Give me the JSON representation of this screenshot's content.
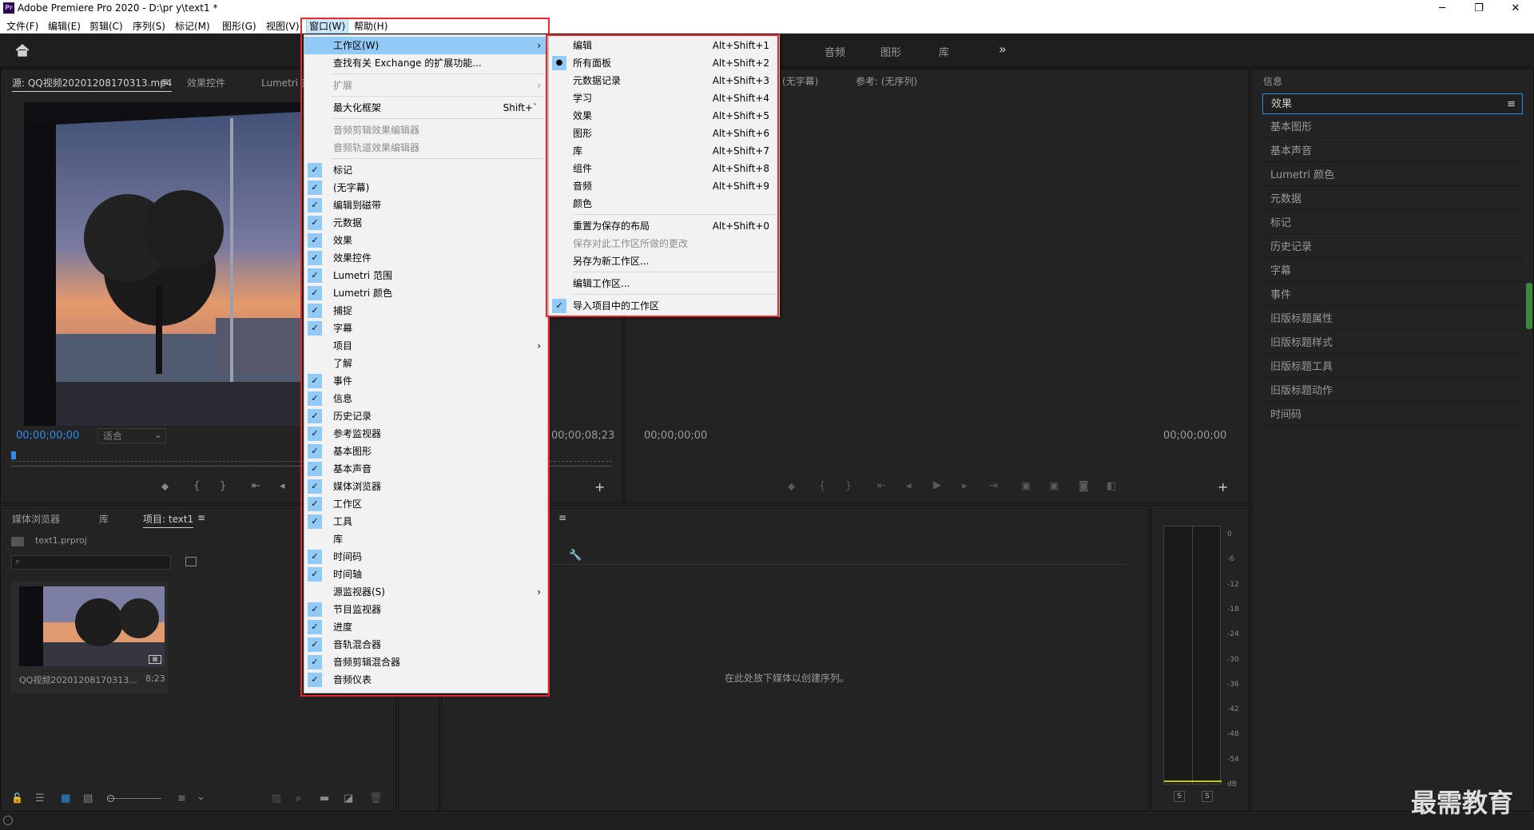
{
  "window": {
    "title": "Adobe Premiere Pro 2020 - D:\\pr y\\text1 *",
    "logo": "Pr",
    "minimize": "─",
    "maximize": "❐",
    "close": "✕"
  },
  "menubar": [
    "文件(F)",
    "编辑(E)",
    "剪辑(C)",
    "序列(S)",
    "标记(M)",
    "图形(G)",
    "视图(V)",
    "窗口(W)",
    "帮助(H)"
  ],
  "workspace_tabs": [
    "音频",
    "图形",
    "库"
  ],
  "workspace_more": "»",
  "source_panel": {
    "tabs": [
      "源: QQ视频20201208170313.mp4",
      "效果控件",
      "Lumetri 范"
    ],
    "menu_icon": "≡",
    "timecode_left": "00;00;00;00",
    "fit": "适合",
    "timecode_right": "00;00;08;23"
  },
  "program_panel": {
    "header_left": "(无字幕)",
    "header_ref": "参考: (无序列)",
    "timecode_left": "00;00;00;00",
    "timecode_right": "00;00;00;00"
  },
  "project_panel": {
    "tabs": [
      "媒体浏览器",
      "库",
      "项目: text1"
    ],
    "menu_icon": "≡",
    "file": "text1.prproj",
    "clip_name": "QQ视频20201208170313...",
    "clip_duration": "8;23"
  },
  "timeline_panel": {
    "empty_text": "在此处放下媒体以创建序列。",
    "menu_icon": "≡"
  },
  "meter": {
    "labels": [
      "0",
      "-6",
      "-12",
      "-18",
      "-24",
      "-30",
      "-36",
      "-42",
      "-48",
      "-54",
      "dB"
    ],
    "solo": [
      "S",
      "S"
    ]
  },
  "effects_panel": {
    "header": "信息",
    "items": [
      "效果",
      "基本图形",
      "基本声音",
      "Lumetri 颜色",
      "元数据",
      "标记",
      "历史记录",
      "字幕",
      "事件",
      "旧版标题属性",
      "旧版标题样式",
      "旧版标题工具",
      "旧版标题动作",
      "时间码"
    ],
    "menu_icon": "≡"
  },
  "window_menu": {
    "items": [
      {
        "label": "工作区(W)",
        "submenu": true,
        "highlight": true
      },
      {
        "label": "查找有关 Exchange 的扩展功能..."
      },
      {
        "sep": true
      },
      {
        "label": "扩展",
        "disabled": true,
        "submenu": true
      },
      {
        "sep": true
      },
      {
        "label": "最大化框架",
        "shortcut": "Shift+`"
      },
      {
        "sep": true
      },
      {
        "label": "音频剪辑效果编辑器",
        "disabled": true
      },
      {
        "label": "音频轨道效果编辑器",
        "disabled": true
      },
      {
        "sep": true
      },
      {
        "label": "标记",
        "checked": true
      },
      {
        "label": "(无字幕)",
        "checked": true
      },
      {
        "label": "编辑到磁带",
        "checked": true
      },
      {
        "label": "元数据",
        "checked": true
      },
      {
        "label": "效果",
        "checked": true
      },
      {
        "label": "效果控件",
        "checked": true
      },
      {
        "label": "Lumetri 范围",
        "checked": true
      },
      {
        "label": "Lumetri 颜色",
        "checked": true
      },
      {
        "label": "捕捉",
        "checked": true
      },
      {
        "label": "字幕",
        "checked": true
      },
      {
        "label": "项目",
        "submenu": true
      },
      {
        "label": "了解"
      },
      {
        "label": "事件",
        "checked": true
      },
      {
        "label": "信息",
        "checked": true
      },
      {
        "label": "历史记录",
        "checked": true
      },
      {
        "label": "参考监视器",
        "checked": true
      },
      {
        "label": "基本图形",
        "checked": true
      },
      {
        "label": "基本声音",
        "checked": true
      },
      {
        "label": "媒体浏览器",
        "checked": true
      },
      {
        "label": "工作区",
        "checked": true
      },
      {
        "label": "工具",
        "checked": true
      },
      {
        "label": "库"
      },
      {
        "label": "时间码",
        "checked": true
      },
      {
        "label": "时间轴",
        "checked": true
      },
      {
        "label": "源监视器(S)",
        "submenu": true
      },
      {
        "label": "节目监视器",
        "checked": true
      },
      {
        "label": "进度",
        "checked": true
      },
      {
        "label": "音轨混合器",
        "checked": true
      },
      {
        "label": "音频剪辑混合器",
        "checked": true
      },
      {
        "label": "音频仪表",
        "checked": true
      }
    ]
  },
  "workspace_menu": {
    "items": [
      {
        "label": "编辑",
        "shortcut": "Alt+Shift+1"
      },
      {
        "label": "所有面板",
        "shortcut": "Alt+Shift+2",
        "bullet": true
      },
      {
        "label": "元数据记录",
        "shortcut": "Alt+Shift+3"
      },
      {
        "label": "学习",
        "shortcut": "Alt+Shift+4"
      },
      {
        "label": "效果",
        "shortcut": "Alt+Shift+5"
      },
      {
        "label": "图形",
        "shortcut": "Alt+Shift+6"
      },
      {
        "label": "库",
        "shortcut": "Alt+Shift+7"
      },
      {
        "label": "组件",
        "shortcut": "Alt+Shift+8"
      },
      {
        "label": "音频",
        "shortcut": "Alt+Shift+9"
      },
      {
        "label": "颜色"
      },
      {
        "sep": true
      },
      {
        "label": "重置为保存的布局",
        "shortcut": "Alt+Shift+0"
      },
      {
        "label": "保存对此工作区所做的更改",
        "disabled": true
      },
      {
        "label": "另存为新工作区..."
      },
      {
        "sep": true
      },
      {
        "label": "编辑工作区..."
      },
      {
        "sep": true
      },
      {
        "label": "导入项目中的工作区",
        "checked": true
      }
    ]
  },
  "watermark": "最需教育",
  "colors": {
    "accent": "#2d8ceb",
    "highlight": "#91c9f7",
    "annotation": "#e8262b"
  }
}
